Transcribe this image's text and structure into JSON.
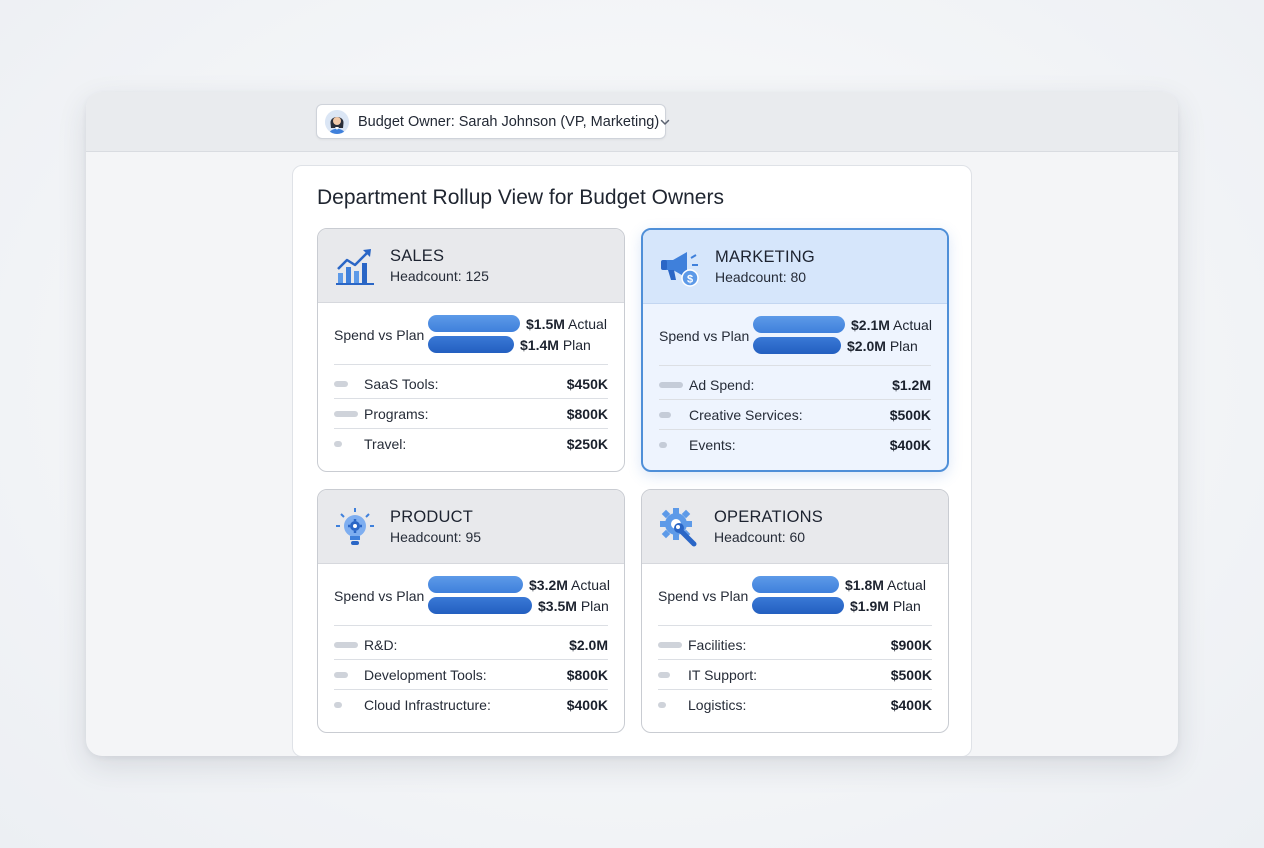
{
  "toolbar": {
    "owner_select_label": "Budget Owner: Sarah Johnson (VP, Marketing)"
  },
  "panel": {
    "title": "Department Rollup View for Budget Owners",
    "spend_label": "Spend vs Plan"
  },
  "departments": [
    {
      "name": "SALES",
      "headcount": "Headcount: 125",
      "icon": "growth-chart-icon",
      "selected": false,
      "actual_value": 1.5,
      "plan_value": 1.4,
      "actual_text": "$1.5M",
      "actual_suffix": "Actual",
      "plan_text": "$1.4M",
      "plan_suffix": "Plan",
      "items": [
        {
          "label": "SaaS Tools:",
          "value": "$450K"
        },
        {
          "label": "Programs:",
          "value": "$800K"
        },
        {
          "label": "Travel:",
          "value": "$250K"
        }
      ]
    },
    {
      "name": "MARKETING",
      "headcount": "Headcount: 80",
      "icon": "megaphone-dollar-icon",
      "selected": true,
      "actual_value": 2.1,
      "plan_value": 2.0,
      "actual_text": "$2.1M",
      "actual_suffix": "Actual",
      "plan_text": "$2.0M",
      "plan_suffix": "Plan",
      "items": [
        {
          "label": "Ad Spend:",
          "value": "$1.2M"
        },
        {
          "label": "Creative Services:",
          "value": "$500K"
        },
        {
          "label": "Events:",
          "value": "$400K"
        }
      ]
    },
    {
      "name": "PRODUCT",
      "headcount": "Headcount: 95",
      "icon": "lightbulb-gear-icon",
      "selected": false,
      "actual_value": 3.2,
      "plan_value": 3.5,
      "actual_text": "$3.2M",
      "actual_suffix": "Actual",
      "plan_text": "$3.5M",
      "plan_suffix": "Plan",
      "items": [
        {
          "label": "R&D:",
          "value": "$2.0M"
        },
        {
          "label": "Development Tools:",
          "value": "$800K"
        },
        {
          "label": "Cloud Infrastructure:",
          "value": "$400K"
        }
      ]
    },
    {
      "name": "OPERATIONS",
      "headcount": "Headcount: 60",
      "icon": "gear-wrench-icon",
      "selected": false,
      "actual_value": 1.8,
      "plan_value": 1.9,
      "actual_text": "$1.8M",
      "actual_suffix": "Actual",
      "plan_text": "$1.9M",
      "plan_suffix": "Plan",
      "items": [
        {
          "label": "Facilities:",
          "value": "$900K"
        },
        {
          "label": "IT Support:",
          "value": "$500K"
        },
        {
          "label": "Logistics:",
          "value": "$400K"
        }
      ]
    }
  ],
  "colors": {
    "accent": "#3f80db",
    "selected_border": "#4f8fd8",
    "selected_bg": "#eef4fe"
  }
}
